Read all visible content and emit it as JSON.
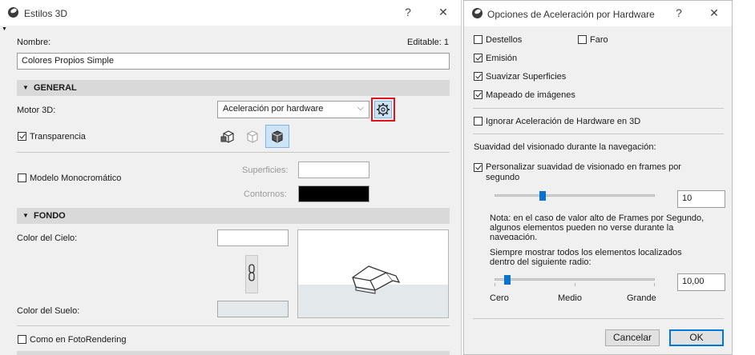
{
  "win1": {
    "title": "Estilos 3D",
    "help": "?",
    "close": "✕",
    "name_label": "Nombre:",
    "editable": "Editable: 1",
    "name_value": "Colores Propios Simple",
    "general": {
      "header": "GENERAL",
      "engine_label": "Motor 3D:",
      "engine_value": "Aceleración por hardware",
      "transparency_label": "Transparencia",
      "transparency_checked": true,
      "mono_label": "Modelo Monocromático",
      "surfaces_label": "Superficies:",
      "contours_label": "Contornos:"
    },
    "fondo": {
      "header": "FONDO",
      "sky_label": "Color del Cielo:",
      "ground_label": "Color del Suelo:",
      "photorender_label": "Como en FotoRendering"
    }
  },
  "win2": {
    "title": "Opciones de Aceleración por Hardware",
    "help": "?",
    "close": "✕",
    "destellos": "Destellos",
    "faro": "Faro",
    "emision": "Emisión",
    "suavizar": "Suavizar Superficies",
    "mapeado": "Mapeado de imágenes",
    "ignorar": "Ignorar Aceleración de Hardware en 3D",
    "suavidad_heading": "Suavidad del visionado durante la navegación:",
    "personalizar_line1": "Personalizar suavidad de visionado en frames por",
    "personalizar_line2": "segundo",
    "fps_value": "10",
    "fps_level": 0.3,
    "note_line1": "Nota: en el caso de valor alto de Frames por Segundo,",
    "note_line2": "algunos elementos pueden no verse durante la",
    "note_line3": "navegación.",
    "siempre_line1": "Siempre mostrar todos los elementos localizados",
    "siempre_line2": "dentro del siguiente radio:",
    "radius_value": "10,00",
    "radius_level": 0.08,
    "scale_low": "Cero",
    "scale_mid": "Medio",
    "scale_high": "Grande",
    "cancel": "Cancelar",
    "ok": "OK"
  },
  "colors": {
    "accent": "#0078d7",
    "highlight_border": "#e0141b",
    "thumb": "#0a72d0"
  }
}
